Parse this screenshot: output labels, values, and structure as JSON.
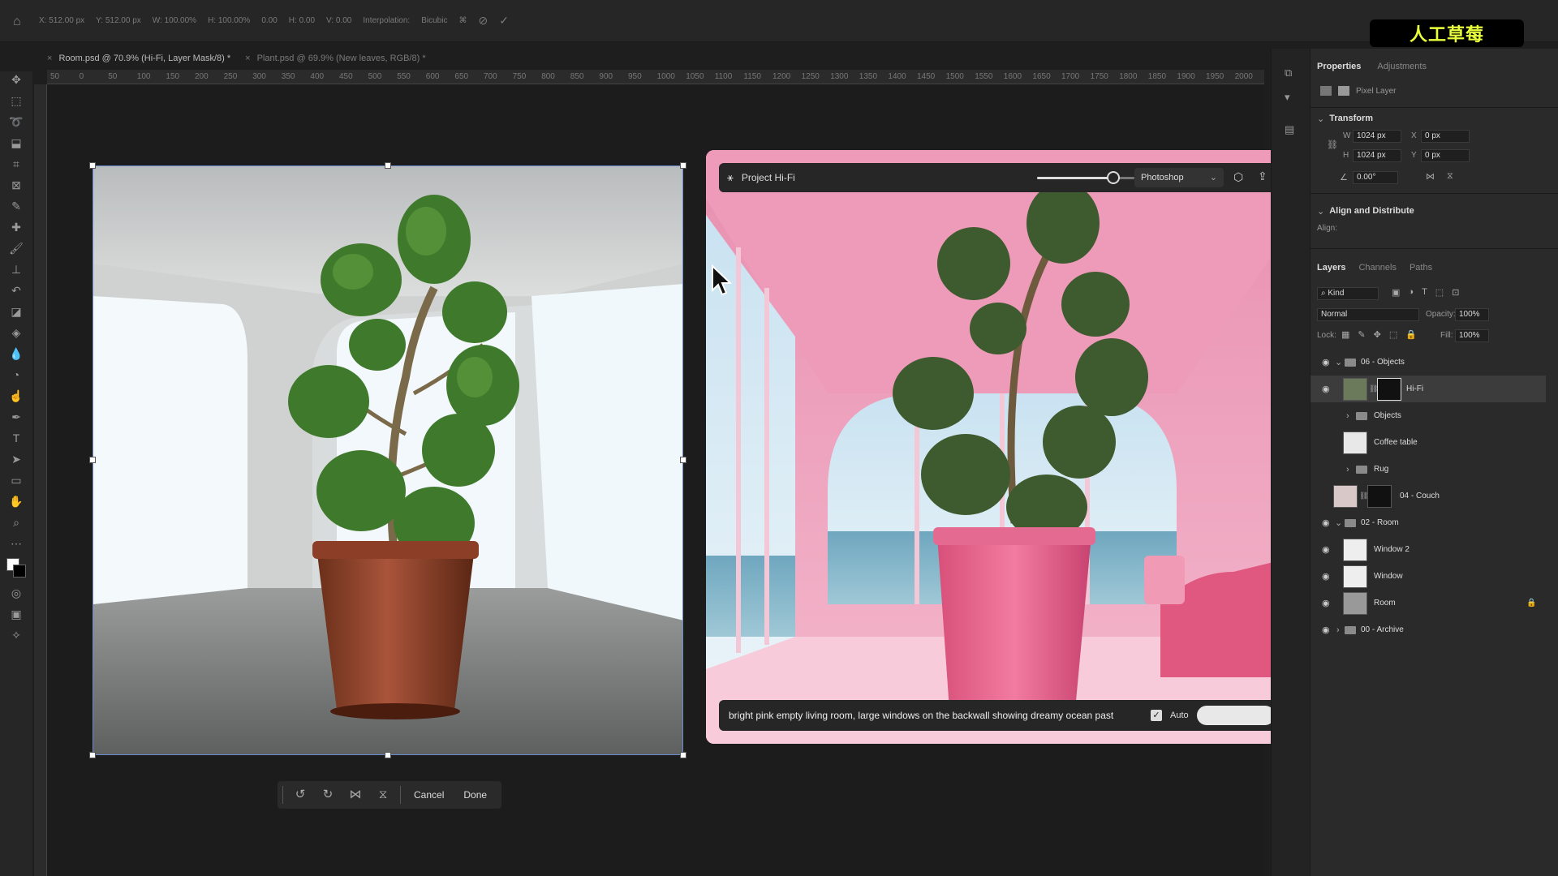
{
  "options_bar": {
    "x": "X: 512.00 px",
    "y": "Y: 512.00 px",
    "w": "W: 100.00%",
    "h": "H: 100.00%",
    "angle": "0.00",
    "hskew": "H: 0.00",
    "vskew": "V: 0.00",
    "interpolation_label": "Interpolation:",
    "interpolation_value": "Bicubic"
  },
  "logo": {
    "text": "人工草莓"
  },
  "tabs": [
    {
      "label": "Room.psd @ 70.9% (Hi-Fi, Layer Mask/8) *"
    },
    {
      "label": "Plant.psd @ 69.9% (New leaves, RGB/8) *"
    }
  ],
  "ruler": [
    "50",
    "0",
    "50",
    "100",
    "150",
    "200",
    "250",
    "300",
    "350",
    "400",
    "450",
    "500",
    "550",
    "600",
    "650",
    "700",
    "750",
    "800",
    "850",
    "900",
    "950",
    "1000",
    "1050",
    "1100",
    "1150",
    "1200",
    "1250",
    "1300",
    "1350",
    "1400",
    "1450",
    "1500",
    "1550",
    "1600",
    "1650",
    "1700",
    "1750",
    "1800",
    "1850",
    "1900",
    "1950",
    "2000"
  ],
  "transform_bar": {
    "cancel": "Cancel",
    "done": "Done"
  },
  "hifi": {
    "title": "Project Hi-Fi",
    "app_select": "Photoshop",
    "slider_value": 0.85,
    "prompt": "bright pink empty living room, large windows on the backwall showing dreamy ocean past",
    "auto_label": "Auto",
    "auto_checked": true
  },
  "properties": {
    "tab_properties": "Properties",
    "tab_adjustments": "Adjustments",
    "layer_type": "Pixel Layer",
    "transform_title": "Transform",
    "w_label": "W",
    "w_value": "1024 px",
    "x_label": "X",
    "x_value": "0 px",
    "h_label": "H",
    "h_value": "1024 px",
    "y_label": "Y",
    "y_value": "0 px",
    "angle_value": "0.00°",
    "align_title": "Align and Distribute",
    "align_label": "Align:"
  },
  "layers_panel": {
    "tab_layers": "Layers",
    "tab_channels": "Channels",
    "tab_paths": "Paths",
    "kind": "Kind",
    "blend": "Normal",
    "opacity_label": "Opacity:",
    "opacity_value": "100%",
    "lock_label": "Lock:",
    "fill_label": "Fill:",
    "fill_value": "100%",
    "layers": [
      {
        "name": "06 - Objects"
      },
      {
        "name": "Hi-Fi"
      },
      {
        "name": "Objects"
      },
      {
        "name": "Coffee table"
      },
      {
        "name": "Rug"
      },
      {
        "name": "04 - Couch"
      },
      {
        "name": "02 - Room"
      },
      {
        "name": "Window 2"
      },
      {
        "name": "Window"
      },
      {
        "name": "Room"
      },
      {
        "name": "00 - Archive"
      }
    ]
  }
}
